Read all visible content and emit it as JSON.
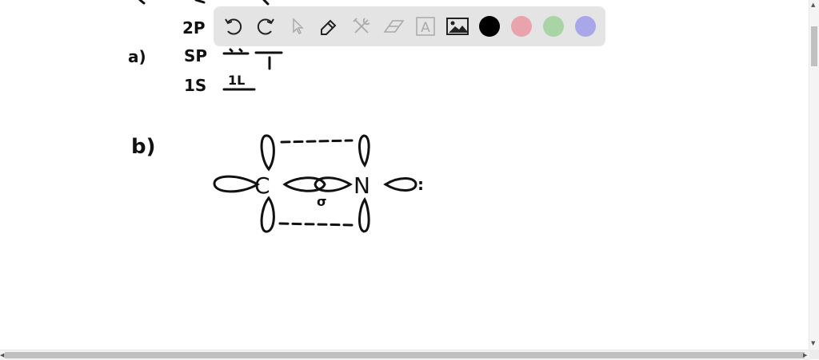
{
  "toolbar": {
    "tools": [
      {
        "name": "undo-icon"
      },
      {
        "name": "redo-icon"
      },
      {
        "name": "pointer-icon"
      },
      {
        "name": "pencil-icon"
      },
      {
        "name": "tools-icon"
      },
      {
        "name": "eraser-icon"
      },
      {
        "name": "text-icon",
        "glyph": "A"
      },
      {
        "name": "image-icon"
      }
    ],
    "colors": [
      "#000000",
      "#e8a3ad",
      "#a9d5a6",
      "#aaa6ea"
    ]
  },
  "drawing": {
    "part_a": "a)",
    "part_b": "b)",
    "orbital_2p": "2P",
    "orbital_sp": "SP",
    "orbital_1s": "1S",
    "electrons_1s": "1L",
    "atom_c": "C",
    "atom_n": "N",
    "sigma": "σ",
    "lone_pair": ":"
  }
}
